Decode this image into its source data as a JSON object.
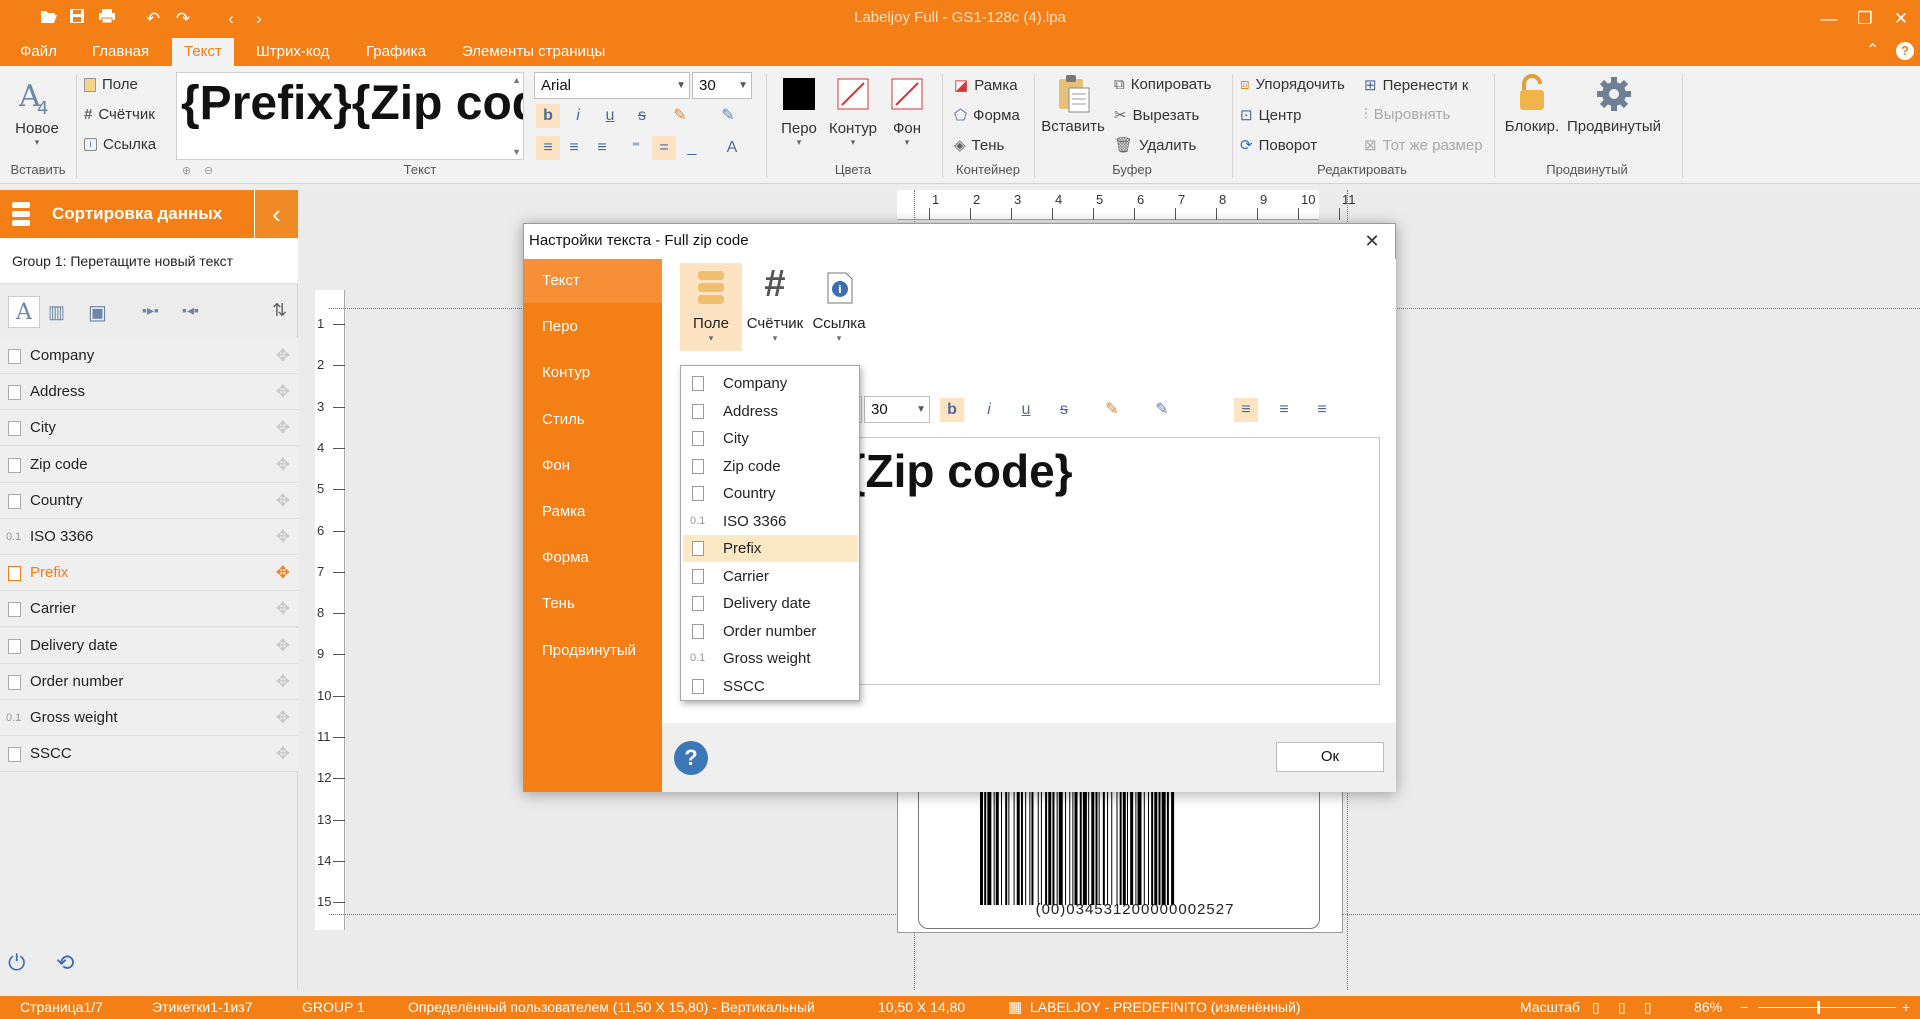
{
  "window": {
    "title": "Labeljoy Full - GS1-128c (4).lpa",
    "min_icon": "—",
    "restore_icon": "❐",
    "close_icon": "✕"
  },
  "menu": [
    "Файл",
    "Главная",
    "Текст",
    "Штрих-код",
    "Графика",
    "Элементы страницы"
  ],
  "menu_active": 2,
  "ribbon": {
    "new_label": "Новое",
    "insert_group": "Вставить",
    "field": "Поле",
    "counter": "Счётчик",
    "link": "Ссылка",
    "preview": "{Prefix}{Zip code}",
    "text_group": "Текст",
    "font": "Arial",
    "size": "30",
    "pen": "Перо",
    "contour": "Контур",
    "background": "Фон",
    "colors_group": "Цвета",
    "frame": "Рамка",
    "shape": "Форма",
    "shadow": "Тень",
    "container_group": "Контейнер",
    "paste": "Вставить",
    "copy": "Копировать",
    "cut": "Вырезать",
    "delete": "Удалить",
    "buffer_group": "Буфер",
    "arrange": "Упорядочить",
    "move_to": "Перенести к",
    "center": "Центр",
    "align": "Выровнять",
    "rotate": "Поворот",
    "same_size": "Тот же размер",
    "edit_group": "Редактировать",
    "lock": "Блокир.",
    "advanced": "Продвинутый",
    "advanced_group": "Продвинутый"
  },
  "left_panel": {
    "title": "Сортировка данных",
    "group": "Group 1: Перетащите новый текст",
    "items": [
      {
        "label": "Company",
        "kind": "field"
      },
      {
        "label": "Address",
        "kind": "field"
      },
      {
        "label": "City",
        "kind": "field"
      },
      {
        "label": "Zip code",
        "kind": "field"
      },
      {
        "label": "Country",
        "kind": "field"
      },
      {
        "label": "ISO 3366",
        "kind": "num"
      },
      {
        "label": "Prefix",
        "kind": "field"
      },
      {
        "label": "Carrier",
        "kind": "field"
      },
      {
        "label": "Delivery date",
        "kind": "date"
      },
      {
        "label": "Order number",
        "kind": "field"
      },
      {
        "label": "Gross weight",
        "kind": "num"
      },
      {
        "label": "SSCC",
        "kind": "field"
      }
    ],
    "selected_index": 6,
    "num_prefix": "0.1"
  },
  "ruler_h": [
    "1",
    "2",
    "3",
    "4",
    "5",
    "6",
    "7",
    "8",
    "9",
    "10",
    "11"
  ],
  "ruler_v": [
    "1",
    "2",
    "3",
    "4",
    "5",
    "6",
    "7",
    "8",
    "9",
    "10",
    "11",
    "12",
    "13",
    "14",
    "15"
  ],
  "barcode_text": "(00)034531200000002527",
  "dialog": {
    "title": "Настройки текста - Full zip code",
    "nav": [
      "Текст",
      "Перо",
      "Контур",
      "Стиль",
      "Фон",
      "Рамка",
      "Форма",
      "Тень",
      "Продвинутый"
    ],
    "nav_active": 0,
    "tool_field": "Поле",
    "tool_counter": "Счётчик",
    "tool_link": "Ссылка",
    "size": "30",
    "edit_text": "{Prefix}{Zip code}",
    "ok": "Ок",
    "help": "?"
  },
  "dropdown": {
    "items": [
      {
        "label": "Company",
        "kind": "field"
      },
      {
        "label": "Address",
        "kind": "field"
      },
      {
        "label": "City",
        "kind": "field"
      },
      {
        "label": "Zip code",
        "kind": "field"
      },
      {
        "label": "Country",
        "kind": "field"
      },
      {
        "label": "ISO 3366",
        "kind": "num"
      },
      {
        "label": "Prefix",
        "kind": "field"
      },
      {
        "label": "Carrier",
        "kind": "field"
      },
      {
        "label": "Delivery date",
        "kind": "date"
      },
      {
        "label": "Order number",
        "kind": "field"
      },
      {
        "label": "Gross weight",
        "kind": "num"
      },
      {
        "label": "SSCC",
        "kind": "field"
      }
    ],
    "highlighted_index": 6
  },
  "status": {
    "page": "Страница1/7",
    "labels": "Этикетки1-1из7",
    "group": "GROUP 1",
    "format": "Определённый пользователем (11,50 X 15,80) - Вертикальный",
    "size": "10,50 X 14,80",
    "template": "LABELJOY - PREDEFINITO (изменённый)",
    "zoom_label": "Масштаб",
    "zoom": "86%",
    "zoom_minus": "−",
    "zoom_plus": "+"
  },
  "colors": {
    "accent": "#f57f17",
    "highlight": "#fde8c6"
  }
}
